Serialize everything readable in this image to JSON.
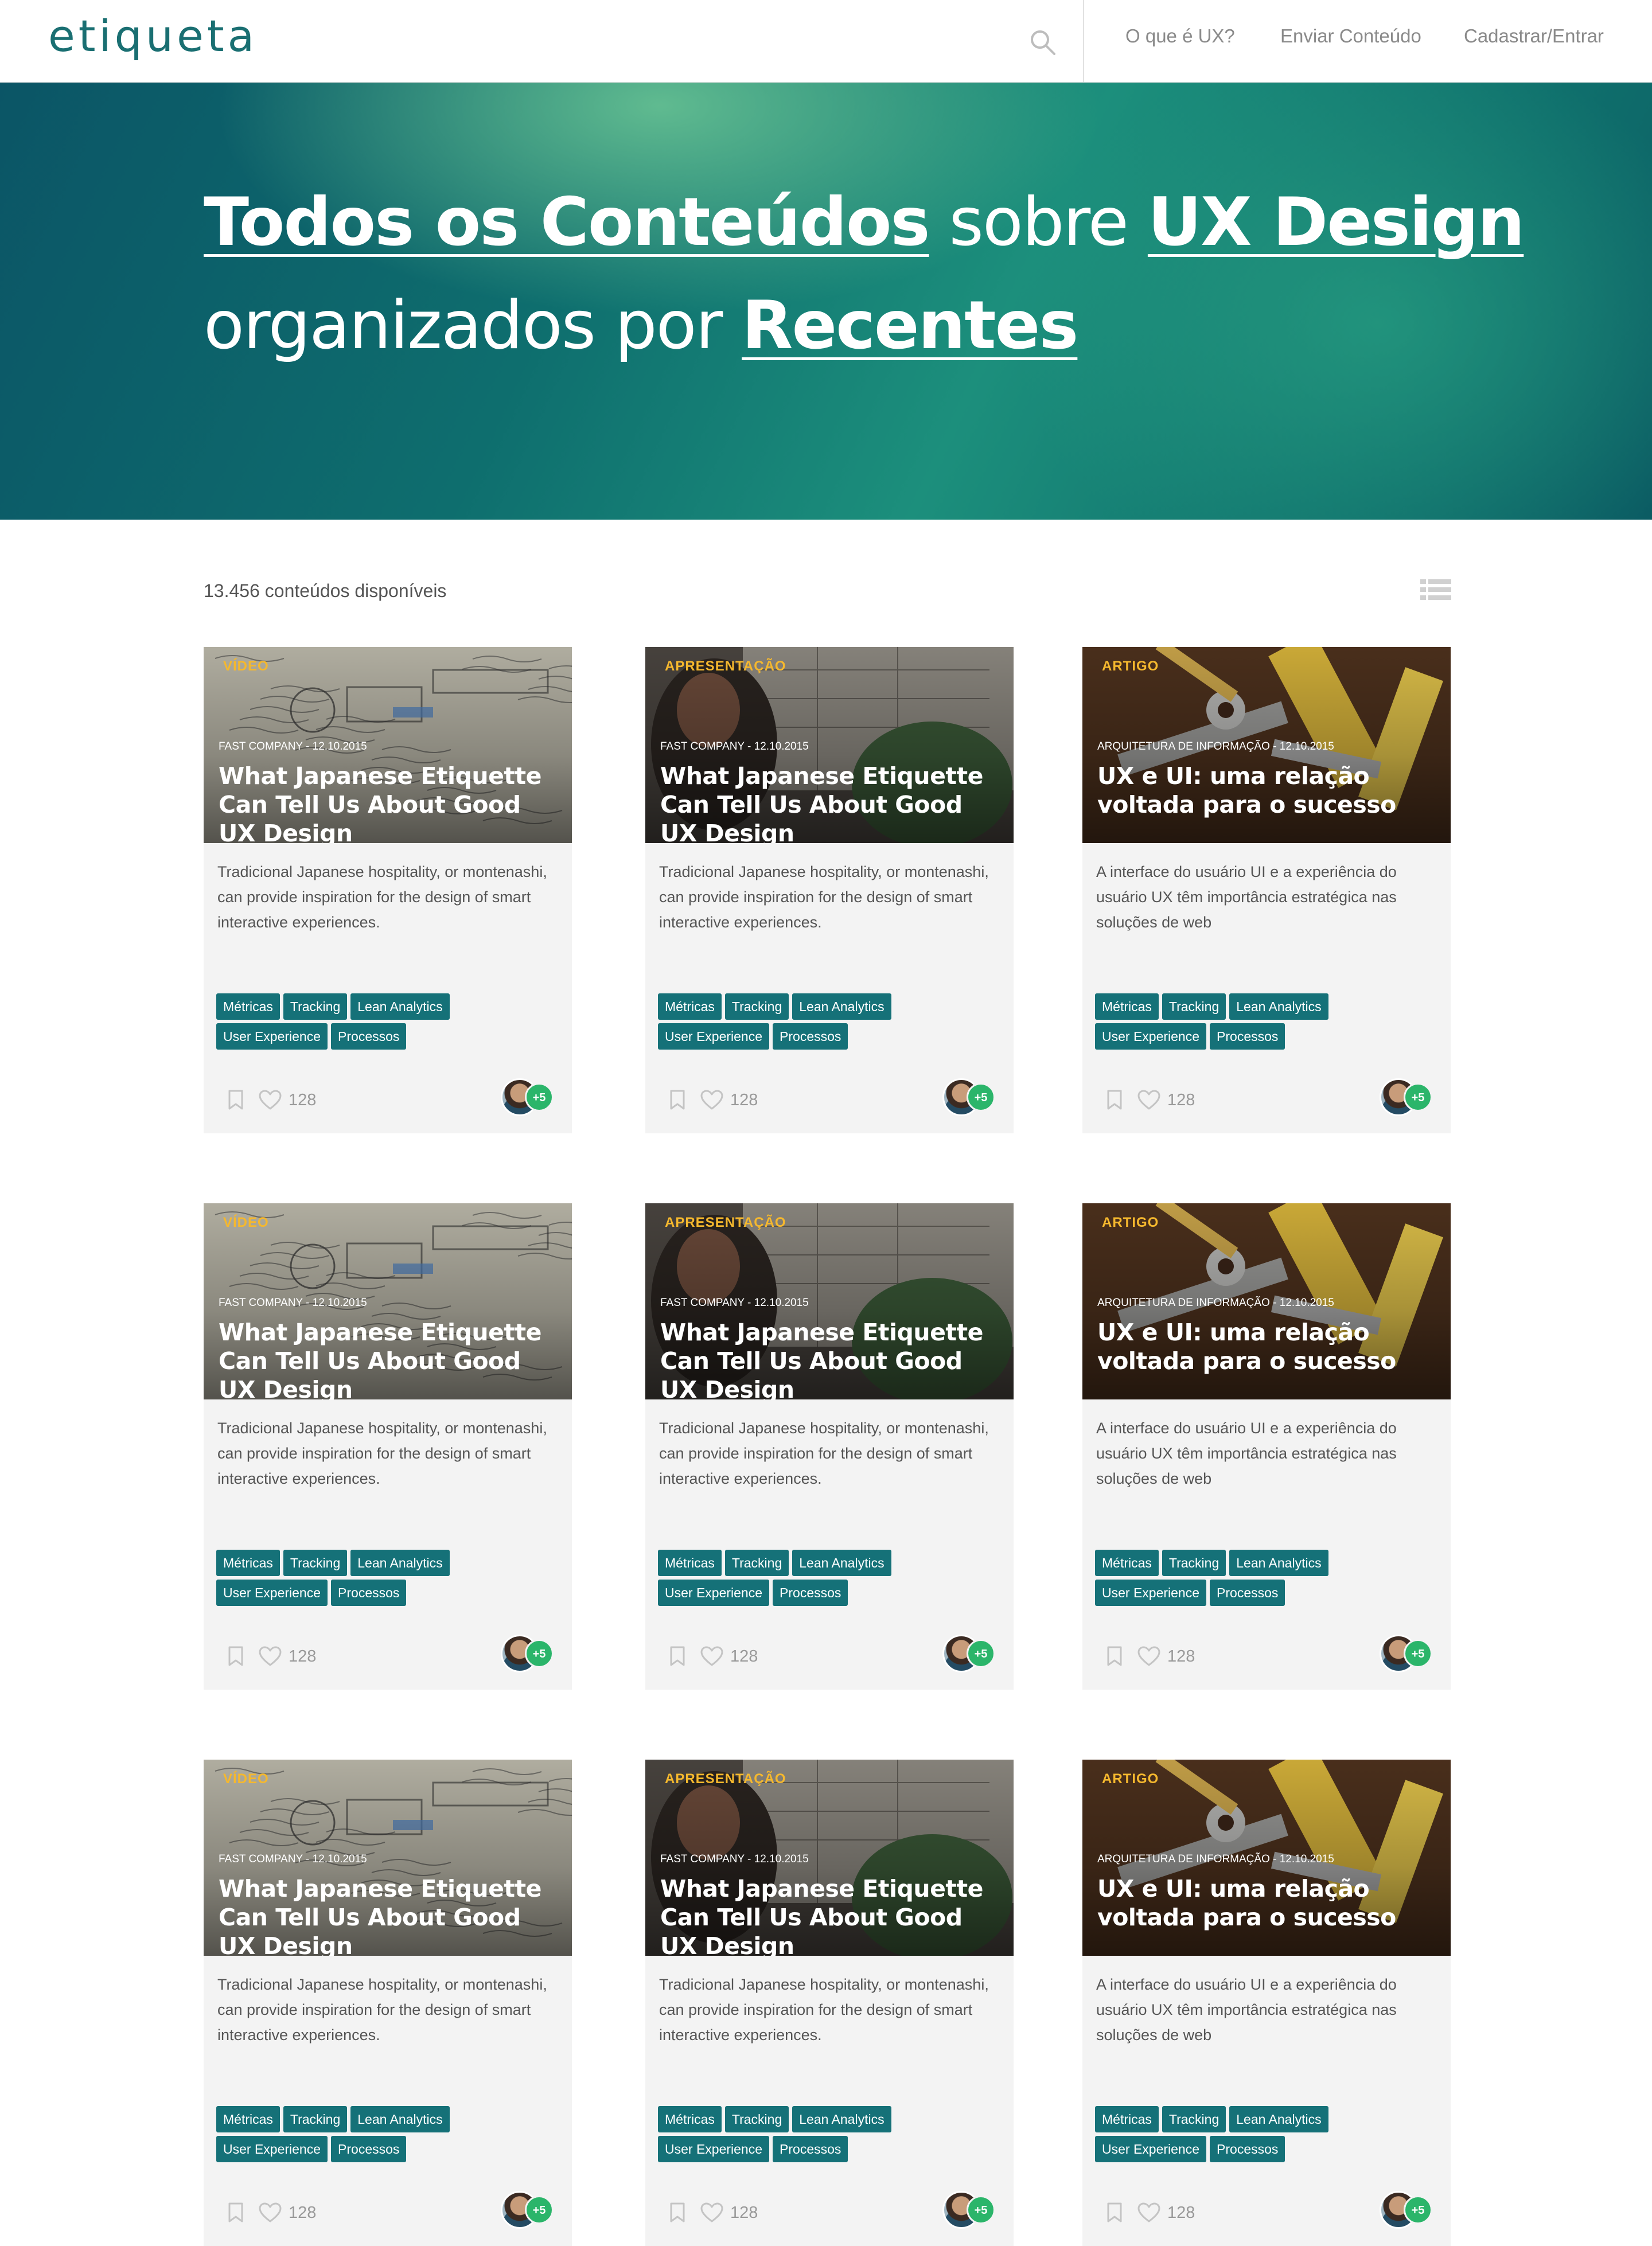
{
  "header": {
    "logo": "etiqueta",
    "nav": [
      {
        "label": "O que é UX?"
      },
      {
        "label": "Enviar Conteúdo"
      },
      {
        "label": "Cadastrar/Entrar"
      }
    ]
  },
  "hero": {
    "part1": "Todos os Conteúdos",
    "part2": "sobre",
    "part3": "UX Design",
    "part4": "organizados por",
    "part5": "Recentes"
  },
  "listing": {
    "count": "13.456 conteúdos disponíveis"
  },
  "cards": [
    {
      "type": "VÍDEO",
      "source": "FAST COMPANY",
      "date": "12.10.2015",
      "title": "What Japanese Etiquette Can Tell Us About Good UX Design",
      "desc": "Tradicional Japanese hospitality, or montenashi, can provide inspiration for the design of smart interactive experiences.",
      "likes": "128",
      "more": "+5",
      "image": "sketch"
    },
    {
      "type": "APRESENTAÇÃO",
      "source": "FAST COMPANY",
      "date": "12.10.2015",
      "title": "What Japanese Etiquette Can Tell Us About Good UX Design",
      "desc": "Tradicional Japanese hospitality, or montenashi, can provide inspiration for the design of smart interactive experiences.",
      "likes": "128",
      "more": "+5",
      "image": "whiteboard"
    },
    {
      "type": "ARTIGO",
      "source": "ARQUITETURA DE INFORMAÇÃO",
      "date": "12.10.2015",
      "title": "UX e UI: uma relação voltada para o sucesso",
      "desc": "A interface do usuário UI e a experiência do usuário UX têm importância estratégica nas soluções de web",
      "likes": "128",
      "more": "+5",
      "image": "tools"
    },
    {
      "type": "VÍDEO",
      "source": "FAST COMPANY",
      "date": "12.10.2015",
      "title": "What Japanese Etiquette Can Tell Us About Good UX Design",
      "desc": "Tradicional Japanese hospitality, or montenashi, can provide inspiration for the design of smart interactive experiences.",
      "likes": "128",
      "more": "+5",
      "image": "sketch"
    },
    {
      "type": "APRESENTAÇÃO",
      "source": "FAST COMPANY",
      "date": "12.10.2015",
      "title": "What Japanese Etiquette Can Tell Us About Good UX Design",
      "desc": "Tradicional Japanese hospitality, or montenashi, can provide inspiration for the design of smart interactive experiences.",
      "likes": "128",
      "more": "+5",
      "image": "whiteboard"
    },
    {
      "type": "ARTIGO",
      "source": "ARQUITETURA DE INFORMAÇÃO",
      "date": "12.10.2015",
      "title": "UX e UI: uma relação voltada para o sucesso",
      "desc": "A interface do usuário UI e a experiência do usuário UX têm importância estratégica nas soluções de web",
      "likes": "128",
      "more": "+5",
      "image": "tools"
    },
    {
      "type": "VÍDEO",
      "source": "FAST COMPANY",
      "date": "12.10.2015",
      "title": "What Japanese Etiquette Can Tell Us About Good UX Design",
      "desc": "Tradicional Japanese hospitality, or montenashi, can provide inspiration for the design of smart interactive experiences.",
      "likes": "128",
      "more": "+5",
      "image": "sketch"
    },
    {
      "type": "APRESENTAÇÃO",
      "source": "FAST COMPANY",
      "date": "12.10.2015",
      "title": "What Japanese Etiquette Can Tell Us About Good UX Design",
      "desc": "Tradicional Japanese hospitality, or montenashi, can provide inspiration for the design of smart interactive experiences.",
      "likes": "128",
      "more": "+5",
      "image": "whiteboard"
    },
    {
      "type": "ARTIGO",
      "source": "ARQUITETURA DE INFORMAÇÃO",
      "date": "12.10.2015",
      "title": "UX e UI: uma relação voltada para o sucesso",
      "desc": "A interface do usuário UI e a experiência do usuário UX têm importância estratégica nas soluções de web",
      "likes": "128",
      "more": "+5",
      "image": "tools"
    }
  ],
  "tag_rows": [
    [
      "Métricas",
      "Tracking",
      "Lean Analytics"
    ],
    [
      "User Experience",
      "Processos"
    ]
  ],
  "colors": {
    "accent": "#157178",
    "badge": "#f5b82e",
    "avatar_count": "#2bb56a"
  }
}
